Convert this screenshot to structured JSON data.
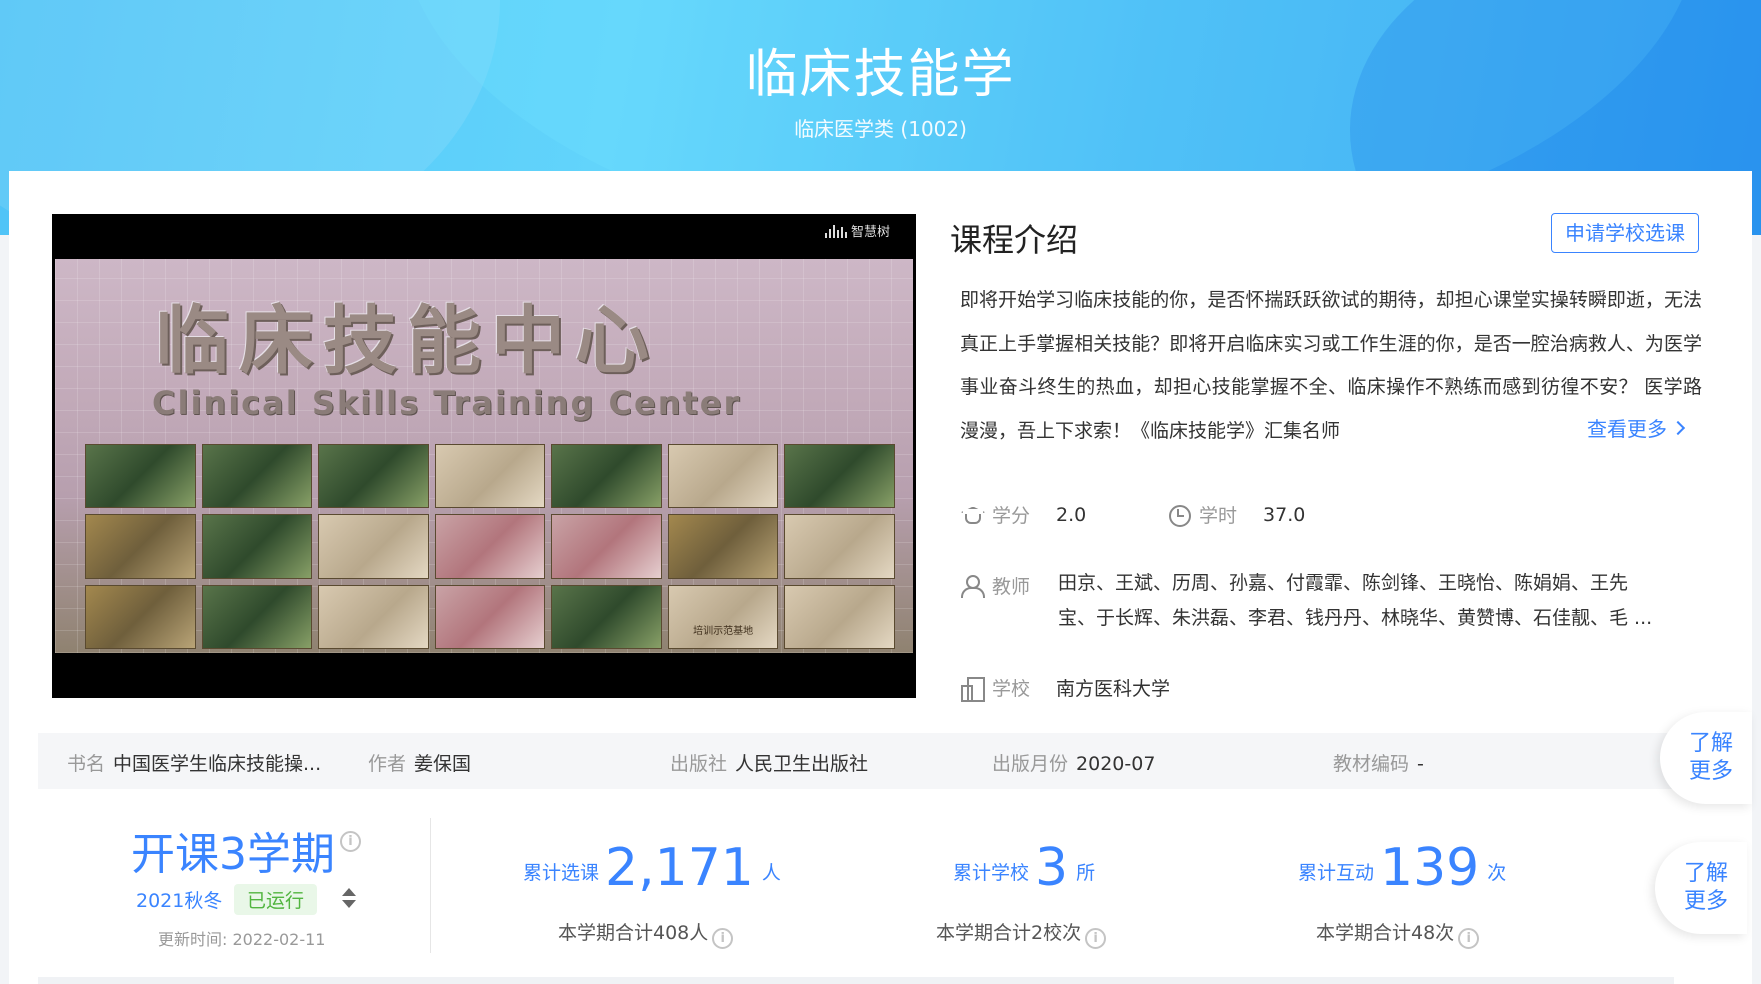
{
  "header": {
    "title": "临床技能学",
    "subtitle": "临床医学类 (1002)"
  },
  "video": {
    "brand": "智慧树",
    "sign_cn": "临床技能中心",
    "sign_en": "Clinical Skills Training Center",
    "plaque_text": "培训示范基地"
  },
  "intro": {
    "title": "课程介绍",
    "apply_label": "申请学校选课",
    "text": "即将开始学习临床技能的你，是否怀揣跃跃欲试的期待，却担心课堂实操转瞬即逝，无法真正上手掌握相关技能？即将开启临床实习或工作生涯的你，是否一腔治病救人、为医学事业奋斗终生的热血，却担心技能掌握不全、临床操作不熟练而感到彷徨不安？ 医学路漫漫，吾上下求索！《临床技能学》汇集名师",
    "see_more": "查看更多"
  },
  "meta": {
    "credit_label": "学分",
    "credit_value": "2.0",
    "hours_label": "学时",
    "hours_value": "37.0",
    "teacher_label": "教师",
    "teachers_line1": "田京、王斌、历周、孙嘉、付霞霏、陈剑锋、王晓怡、陈娟娟、王先",
    "teachers_line2": "宝、于长辉、朱洪磊、李君、钱丹丹、林晓华、黄赞博、石佳靓、毛 ...",
    "school_label": "学校",
    "school_value": "南方医科大学"
  },
  "book": {
    "name_label": "书名",
    "name_value": "中国医学生临床技能操...",
    "author_label": "作者",
    "author_value": "姜保国",
    "publisher_label": "出版社",
    "publisher_value": "人民卫生出版社",
    "date_label": "出版月份",
    "date_value": "2020-07",
    "code_label": "教材编码",
    "code_value": "-"
  },
  "learn_more": {
    "line1": "了解",
    "line2": "更多"
  },
  "term": {
    "title": "开课3学期",
    "season": "2021秋冬",
    "status": "已运行",
    "updated": "更新时间:   2022-02-11"
  },
  "stats": [
    {
      "label": "累计选课",
      "value": "2,171",
      "unit": "人",
      "sub": "本学期合计408人"
    },
    {
      "label": "累计学校",
      "value": "3",
      "unit": "所",
      "sub": "本学期合计2校次"
    },
    {
      "label": "累计互动",
      "value": "139",
      "unit": "次",
      "sub": "本学期合计48次"
    }
  ],
  "colors": {
    "accent": "#3a84ff",
    "hero_start": "#4fc3f7",
    "hero_end": "#2f9cf0",
    "status_green": "#52b540"
  },
  "icons": [
    "mortarboard-icon",
    "clock-icon",
    "user-icon",
    "building-icon",
    "info-icon",
    "sort-icon",
    "chevron-right-icon"
  ]
}
